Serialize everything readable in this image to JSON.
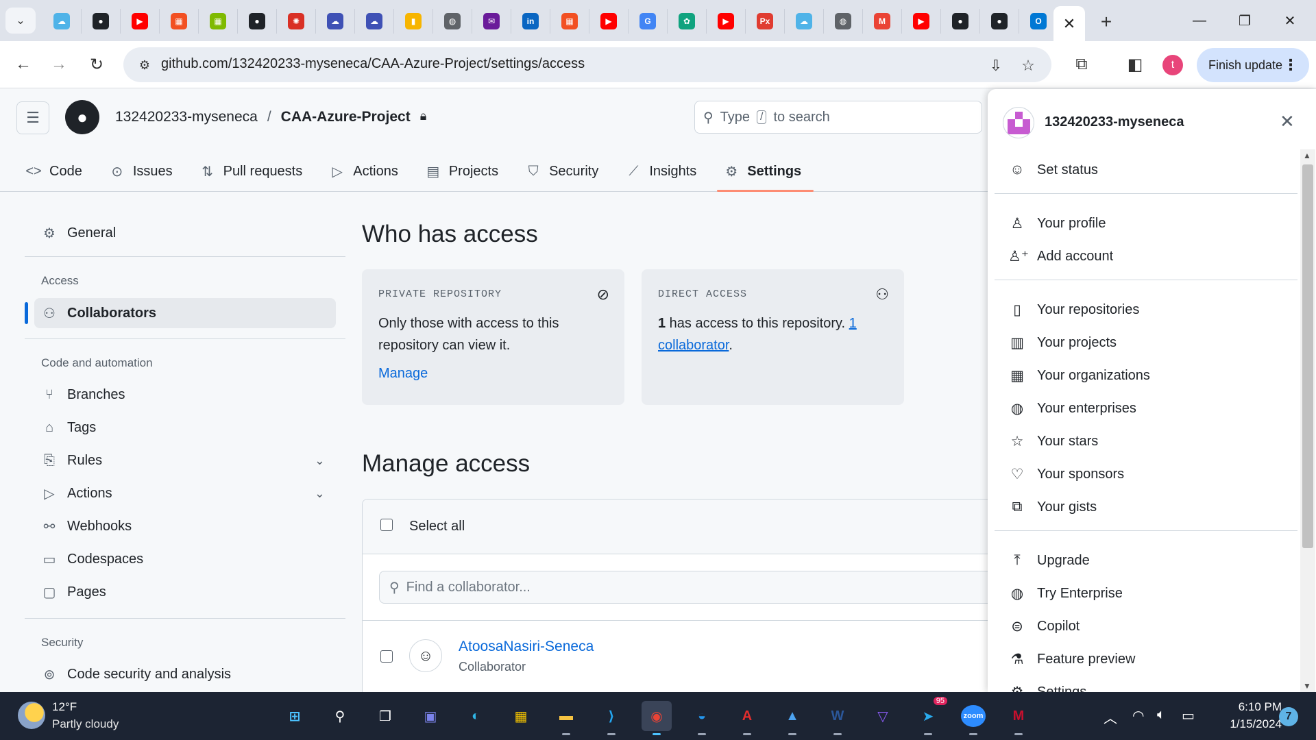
{
  "browser": {
    "url": "github.com/132420233-myseneca/CAA-Azure-Project/settings/access",
    "finish_update_label": "Finish update",
    "profile_initial": "t",
    "bookmark_favicons": [
      {
        "icon": "cloud-icon",
        "color": "#4fb3e8",
        "glyph": "☁"
      },
      {
        "icon": "github-icon",
        "color": "#1f2328",
        "glyph": "●"
      },
      {
        "icon": "youtube-icon",
        "color": "#ff0000",
        "glyph": "▶"
      },
      {
        "icon": "microsoft-icon",
        "color": "#f25022",
        "glyph": "▦"
      },
      {
        "icon": "microsoft-icon",
        "color": "#7fba00",
        "glyph": "▦"
      },
      {
        "icon": "github-icon",
        "color": "#1f2328",
        "glyph": "●"
      },
      {
        "icon": "wheel-icon",
        "color": "#d93025",
        "glyph": "✺"
      },
      {
        "icon": "cloud-icon",
        "color": "#3f51b5",
        "glyph": "☁"
      },
      {
        "icon": "cloud-icon",
        "color": "#3f51b5",
        "glyph": "☁"
      },
      {
        "icon": "chart-icon",
        "color": "#f7b500",
        "glyph": "▮"
      },
      {
        "icon": "globe-icon",
        "color": "#5f6368",
        "glyph": "◍"
      },
      {
        "icon": "mail-icon",
        "color": "#6a1b9a",
        "glyph": "✉"
      },
      {
        "icon": "linkedin-icon",
        "color": "#0a66c2",
        "glyph": "in"
      },
      {
        "icon": "microsoft-icon",
        "color": "#f25022",
        "glyph": "▦"
      },
      {
        "icon": "youtube-icon",
        "color": "#ff0000",
        "glyph": "▶"
      },
      {
        "icon": "google-icon",
        "color": "#4285f4",
        "glyph": "G"
      },
      {
        "icon": "chatgpt-icon",
        "color": "#10a37f",
        "glyph": "✿"
      },
      {
        "icon": "youtube-icon",
        "color": "#ff0000",
        "glyph": "▶"
      },
      {
        "icon": "px-icon",
        "color": "#e03c31",
        "glyph": "Px"
      },
      {
        "icon": "cloud-icon",
        "color": "#4fb3e8",
        "glyph": "☁"
      },
      {
        "icon": "globe-icon",
        "color": "#5f6368",
        "glyph": "◍"
      },
      {
        "icon": "gmail-icon",
        "color": "#ea4335",
        "glyph": "M"
      },
      {
        "icon": "youtube-icon",
        "color": "#ff0000",
        "glyph": "▶"
      },
      {
        "icon": "apple-icon",
        "color": "#1f2328",
        "glyph": "●"
      },
      {
        "icon": "github-icon",
        "color": "#1f2328",
        "glyph": "●"
      },
      {
        "icon": "outlook-icon",
        "color": "#0078d4",
        "glyph": "O"
      }
    ]
  },
  "github": {
    "owner": "132420233-myseneca",
    "separator": "/",
    "repo": "CAA-Azure-Project",
    "search": {
      "prefix": "Type",
      "key": "/",
      "suffix": "to search"
    },
    "repo_nav": [
      {
        "label": "Code",
        "icon": "code-icon",
        "glyph": "<>"
      },
      {
        "label": "Issues",
        "icon": "issue-icon",
        "glyph": "⊙"
      },
      {
        "label": "Pull requests",
        "icon": "pull-request-icon",
        "glyph": "⇅"
      },
      {
        "label": "Actions",
        "icon": "play-icon",
        "glyph": "▷"
      },
      {
        "label": "Projects",
        "icon": "table-icon",
        "glyph": "▤"
      },
      {
        "label": "Security",
        "icon": "shield-icon",
        "glyph": "⛉"
      },
      {
        "label": "Insights",
        "icon": "graph-icon",
        "glyph": "⟋"
      },
      {
        "label": "Settings",
        "icon": "gear-icon",
        "glyph": "⚙"
      }
    ]
  },
  "sidebar": {
    "general": "General",
    "access_heading": "Access",
    "collaborators": "Collaborators",
    "code_heading": "Code and automation",
    "code_items": [
      {
        "label": "Branches",
        "icon": "branch-icon",
        "glyph": "⑂"
      },
      {
        "label": "Tags",
        "icon": "tag-icon",
        "glyph": "⌂"
      },
      {
        "label": "Rules",
        "icon": "rules-icon",
        "glyph": "⎘"
      },
      {
        "label": "Actions",
        "icon": "play-icon",
        "glyph": "▷"
      },
      {
        "label": "Webhooks",
        "icon": "webhook-icon",
        "glyph": "⚯"
      },
      {
        "label": "Codespaces",
        "icon": "codespaces-icon",
        "glyph": "▭"
      },
      {
        "label": "Pages",
        "icon": "browser-icon",
        "glyph": "▢"
      }
    ],
    "security_heading": "Security",
    "code_security": "Code security and analysis"
  },
  "main": {
    "who_title": "Who has access",
    "private_card": {
      "title": "PRIVATE REPOSITORY",
      "text": "Only those with access to this repository can view it.",
      "manage": "Manage"
    },
    "direct_card": {
      "title": "DIRECT ACCESS",
      "count": "1",
      "text": " has access to this repository. ",
      "link": "1 collaborator",
      "end": "."
    },
    "manage_title": "Manage access",
    "select_all": "Select all",
    "find_placeholder": "Find a collaborator...",
    "collaborator": {
      "name": "AtoosaNasiri-Seneca",
      "role": "Collaborator"
    }
  },
  "user_menu": {
    "username": "132420233-myseneca",
    "groups": [
      [
        {
          "label": "Set status",
          "icon": "smiley-icon",
          "glyph": "☺"
        }
      ],
      [
        {
          "label": "Your profile",
          "icon": "person-icon",
          "glyph": "♙"
        },
        {
          "label": "Add account",
          "icon": "person-add-icon",
          "glyph": "♙⁺"
        }
      ],
      [
        {
          "label": "Your repositories",
          "icon": "repo-icon",
          "glyph": "▯"
        },
        {
          "label": "Your projects",
          "icon": "project-icon",
          "glyph": "▥"
        },
        {
          "label": "Your organizations",
          "icon": "organization-icon",
          "glyph": "▦"
        },
        {
          "label": "Your enterprises",
          "icon": "globe-icon",
          "glyph": "◍"
        },
        {
          "label": "Your stars",
          "icon": "star-icon",
          "glyph": "☆"
        },
        {
          "label": "Your sponsors",
          "icon": "heart-icon",
          "glyph": "♡"
        },
        {
          "label": "Your gists",
          "icon": "code-square-icon",
          "glyph": "⧉"
        }
      ],
      [
        {
          "label": "Upgrade",
          "icon": "upload-icon",
          "glyph": "⤒"
        },
        {
          "label": "Try Enterprise",
          "icon": "globe-icon",
          "glyph": "◍"
        },
        {
          "label": "Copilot",
          "icon": "copilot-icon",
          "glyph": "⊜"
        },
        {
          "label": "Feature preview",
          "icon": "beaker-icon",
          "glyph": "⚗"
        },
        {
          "label": "Settings",
          "icon": "gear-icon",
          "glyph": "⚙"
        }
      ]
    ]
  },
  "taskbar": {
    "temperature": "12°F",
    "weather": "Partly cloudy",
    "time": "6:10 PM",
    "date": "1/15/2024",
    "notifications": "7",
    "telegram_badge": "95",
    "apps": [
      {
        "name": "start-button",
        "glyph": "⊞",
        "color": "#4cc2ff"
      },
      {
        "name": "search-button",
        "glyph": "⚲",
        "color": "#ffffff"
      },
      {
        "name": "task-view-button",
        "glyph": "❐",
        "color": "#ffffff"
      },
      {
        "name": "teams-app",
        "glyph": "▣",
        "color": "#7b83eb"
      },
      {
        "name": "edge-app",
        "glyph": "◐",
        "color": "#2fb5e5"
      },
      {
        "name": "store-app",
        "glyph": "▦",
        "color": "#f2c200"
      },
      {
        "name": "file-explorer-app",
        "glyph": "▬",
        "color": "#f6c342"
      },
      {
        "name": "vscode-app",
        "glyph": "⟩",
        "color": "#23a7f2"
      },
      {
        "name": "chrome-app",
        "glyph": "◉",
        "color": "#ea4335"
      },
      {
        "name": "docker-app",
        "glyph": "◒",
        "color": "#2496ed"
      },
      {
        "name": "acrobat-app",
        "glyph": "A",
        "color": "#e32d2d"
      },
      {
        "name": "photos-app",
        "glyph": "▲",
        "color": "#4da3f0"
      },
      {
        "name": "word-app",
        "glyph": "W",
        "color": "#2b579a"
      },
      {
        "name": "vpn-app",
        "glyph": "▽",
        "color": "#8b5cf6"
      },
      {
        "name": "telegram-app",
        "glyph": "➤",
        "color": "#2aabee"
      },
      {
        "name": "zoom-app",
        "glyph": "zoom",
        "color": "#2d8cff"
      },
      {
        "name": "mcafee-app",
        "glyph": "M",
        "color": "#c8102e"
      }
    ]
  }
}
